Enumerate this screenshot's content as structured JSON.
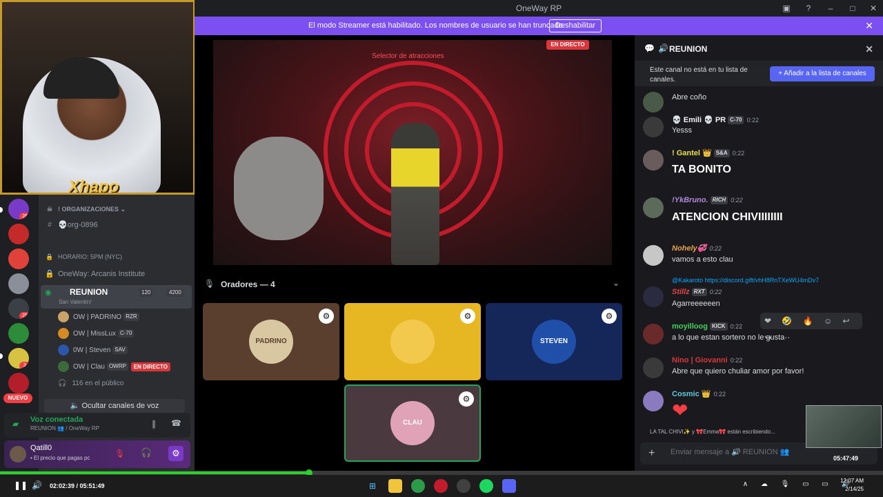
{
  "window": {
    "title": "OneWay RP",
    "controls": [
      "inbox-icon",
      "help-icon",
      "minimize-icon",
      "maximize-icon",
      "close-icon"
    ]
  },
  "banner": {
    "text": "El modo Streamer está habilitado. Los nombres de usuario se han truncado.",
    "button": "Deshabilitar",
    "color": "#7b4ff0"
  },
  "webcam": {
    "label": "Xhapo"
  },
  "servers": [
    {
      "badge": "26",
      "color": "#7a3ac8"
    },
    {
      "badge": "",
      "color": "#c42a2a"
    },
    {
      "badge": "",
      "color": "#e0423a"
    },
    {
      "badge": "",
      "color": "#8a8f99"
    },
    {
      "badge": "29",
      "color": "#3b3f46"
    },
    {
      "badge": "",
      "color": "#2c8c3a"
    },
    {
      "badge": "3",
      "color": "#d6c342"
    },
    {
      "badge": "",
      "color": "#b21e2a"
    }
  ],
  "new_badge": "NUEVO",
  "sidebar": {
    "category": "! ORGANIZACIONES",
    "channel_org": "💀org-0896",
    "channel_schedule": "HORARIO: 5PM (NYC)",
    "channel_institute": "OneWay: Arcanis Institute",
    "voice_channel": {
      "name": "REUNION",
      "subtitle": "San Valentín!",
      "count_a": "120",
      "count_b": "4200"
    },
    "members": [
      {
        "name": "OW | PADRINO",
        "tag": "RZR",
        "color": "#c9a36a",
        "live": ""
      },
      {
        "name": "OW | MissLux",
        "tag": "C-70",
        "color": "#d58a24",
        "live": ""
      },
      {
        "name": "0W | Steven",
        "tag": "SAV",
        "color": "#2c56a8",
        "live": ""
      },
      {
        "name": "OW | Clau",
        "tag": "OWRP",
        "color": "#3d6a3b",
        "live": "EN DIRECTO"
      }
    ],
    "audience": "116 en el público",
    "hide_voice": "Ocultar canales de voz"
  },
  "voice_panel": {
    "status": "Voz conectada",
    "channel": "REUNION 👥 / OneWay RP"
  },
  "user_panel": {
    "name": "Qatill0",
    "status": "• El precio que pagas pc"
  },
  "stage": {
    "live_label": "EN DIRECTO",
    "stream_title": "Selector de atracciones",
    "speakers_label": "Oradores — 4",
    "tiles": [
      {
        "label": "PADRINO",
        "bg": "#5a3f2f",
        "avatar": "#d8c7a0"
      },
      {
        "label": "",
        "bg": "#e7b623",
        "avatar": "#f2c94c"
      },
      {
        "label": "STEVEN",
        "bg": "#152659",
        "avatar": "#1f4fa8"
      },
      {
        "label": "CLAU",
        "bg": "#4a3a3f",
        "avatar": "#e0a2b6"
      }
    ]
  },
  "chat": {
    "header": "REUNION",
    "notice": "Este canal no está en tu lista de canales.",
    "add_button": "+ Añadir a la lista de canales",
    "messages": [
      {
        "user": "",
        "tag": "",
        "time": "",
        "text": "Abre coño",
        "color": "#dbdee1",
        "avatar": "#4a5a48",
        "big": false
      },
      {
        "user": "💀 Emili 💀 PR",
        "tag": "C-70",
        "time": "0:22",
        "text": "Yesss",
        "color": "#f2f3f5",
        "avatar": "#3a3a3a",
        "big": false
      },
      {
        "user": "! Gantel 👑",
        "tag": "S&A",
        "time": "0:22",
        "text": "TA BONITO",
        "color": "#e7e04a",
        "avatar": "#6a5c5c",
        "big": true
      },
      {
        "user": "!YkBruno.",
        "tag": "RICH",
        "time": "0:22",
        "text": "ATENCION CHIVIIIIIIII",
        "color": "#b08adf",
        "avatar": "#5c6a5a",
        "big": true
      },
      {
        "user": "Nohely💞",
        "tag": "",
        "time": "0:22",
        "text": "vamos a esto clau",
        "color": "#e7a24a",
        "avatar": "#c7c7c7",
        "big": false
      },
      {
        "user": "Stillz",
        "tag": "RXT",
        "time": "0:22",
        "text": "Agarreeeeeen",
        "color": "#e04545",
        "avatar": "#2a2a40",
        "big": false
      },
      {
        "user": "moyilloog",
        "tag": "KICK",
        "time": "0:22",
        "text": "a lo que estan sortero no le gusta",
        "color": "#3fd25a",
        "avatar": "#6a2a2a",
        "big": false
      },
      {
        "user": "Nino | Giovanni",
        "tag": "",
        "time": "0:22",
        "text": "Abre que quiero chuliar amor por favor!",
        "color": "#d6383a",
        "avatar": "#3a3a3a",
        "big": false
      },
      {
        "user": "Cosmic 👑",
        "tag": "",
        "time": "0:22",
        "text": "❤",
        "color": "#5fc7e0",
        "avatar": "#8a7ac0",
        "big": true
      }
    ],
    "reply_link": "@Kakaroto https://discord.gift/vhH8RnTXeWU4mDv7",
    "reactions": "❤ 🤣 🔥 ☺ ↩ ↪ ⋯",
    "typing": "LA TAL CHIVI✨ y 🎀Emma🎀 están escribiendo...",
    "composer_placeholder": "Enviar mensaje a 🔊 REUNION 👥"
  },
  "mini_player_time": "05:47:49",
  "player": {
    "time": "02:02:39 / 05:51:49",
    "progress": 0.35
  },
  "taskbar": {
    "apps": [
      "windows-icon",
      "folder-icon",
      "chrome-icon",
      "record-icon",
      "obs-icon",
      "spotify-icon",
      "discord-icon"
    ],
    "tray": "∧ ☁ 🎙 ▭ ▭ 🔊",
    "clock_time": "12:07 AM",
    "clock_date": "2/14/25"
  }
}
